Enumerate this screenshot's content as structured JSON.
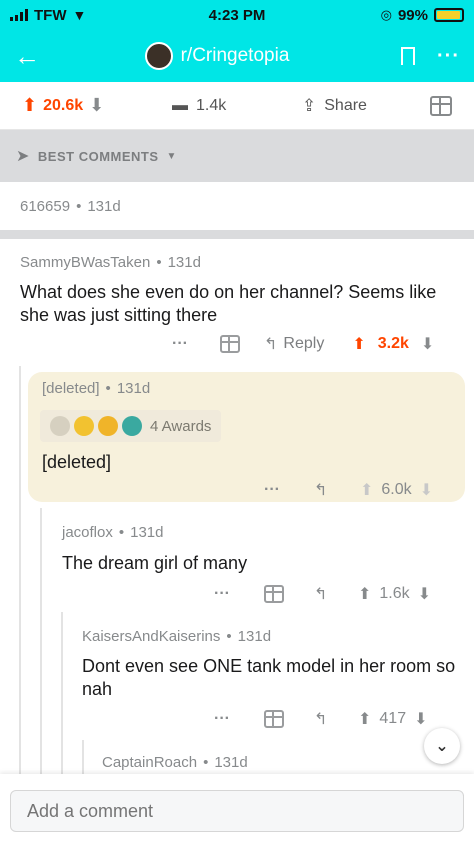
{
  "status": {
    "carrier": "TFW",
    "time": "4:23 PM",
    "battery": "99%"
  },
  "header": {
    "subreddit": "r/Cringetopia"
  },
  "post_actions": {
    "score": "20.6k",
    "comments": "1.4k",
    "share": "Share"
  },
  "sort": {
    "label": "BEST COMMENTS"
  },
  "deleted_post_meta": {
    "user": "616659",
    "age": "131d"
  },
  "comments": [
    {
      "user": "SammyBWasTaken",
      "age": "131d",
      "text": "What does she even do on her channel? Seems like she was just sitting there",
      "reply": "Reply",
      "score": "3.2k"
    },
    {
      "user": "[deleted]",
      "age": "131d",
      "awards": "4 Awards",
      "text": "[deleted]",
      "score": "6.0k"
    },
    {
      "user": "jacoflox",
      "age": "131d",
      "text": "The dream girl of many",
      "score": "1.6k"
    },
    {
      "user": "KaisersAndKaiserins",
      "age": "131d",
      "text": "Dont even see ONE tank model in her room so nah",
      "score": "417"
    },
    {
      "user": "CaptainRoach",
      "age": "131d"
    }
  ],
  "composer": {
    "placeholder": "Add a comment"
  },
  "colors": {
    "header": "#00e6e6",
    "upvote": "#ff4500",
    "deleted_bg": "#f7f1dc"
  }
}
